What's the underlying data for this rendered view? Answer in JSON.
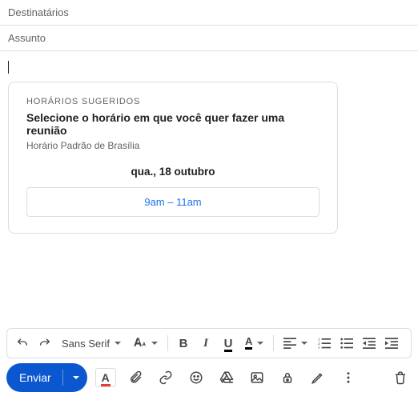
{
  "fields": {
    "recipients_placeholder": "Destinatários",
    "subject_placeholder": "Assunto"
  },
  "card": {
    "eyebrow": "HORÁRIOS SUGERIDOS",
    "title": "Selecione o horário em que você quer fazer uma reunião",
    "subtitle": "Horário Padrão de Brasília",
    "date": "qua., 18 outubro",
    "slot": "9am – 11am"
  },
  "format": {
    "font_label": "Sans Serif",
    "bold": "B",
    "italic": "I",
    "underline": "U",
    "text_color": "A"
  },
  "send": {
    "label": "Enviar",
    "text_color_boxed": "A"
  }
}
